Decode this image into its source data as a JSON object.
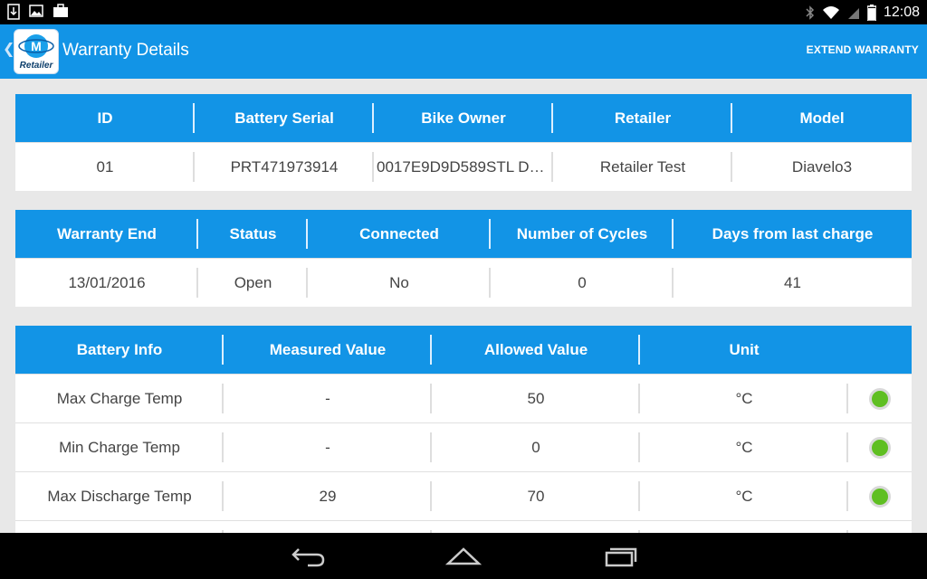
{
  "status_bar": {
    "time": "12:08",
    "left_icons": [
      "download-icon",
      "image-icon",
      "briefcase-icon"
    ],
    "right_icons": [
      "bluetooth-icon",
      "wifi-icon",
      "signal-icon",
      "battery-icon"
    ]
  },
  "action_bar": {
    "logo_text": "Retailer",
    "title": "Warranty Details",
    "action": "EXTEND WARRANTY"
  },
  "table1": {
    "headers": [
      "ID",
      "Battery Serial",
      "Bike Owner",
      "Retailer",
      "Model"
    ],
    "row": [
      "01",
      "PRT471973914",
      "0017E9D9D589STL D…",
      "Retailer Test",
      "Diavelo3"
    ]
  },
  "table2": {
    "headers": [
      "Warranty End",
      "Status",
      "Connected",
      "Number of Cycles",
      "Days from last charge"
    ],
    "row": [
      "13/01/2016",
      "Open",
      "No",
      "0",
      "41"
    ]
  },
  "table3": {
    "headers": [
      "Battery Info",
      "Measured Value",
      "Allowed Value",
      "Unit"
    ],
    "rows": [
      {
        "label": "Max Charge Temp",
        "measured": "-",
        "allowed": "50",
        "unit": "°C",
        "status_color": "#5fbf22"
      },
      {
        "label": "Min Charge Temp",
        "measured": "-",
        "allowed": "0",
        "unit": "°C",
        "status_color": "#5fbf22"
      },
      {
        "label": "Max Discharge Temp",
        "measured": "29",
        "allowed": "70",
        "unit": "°C",
        "status_color": "#5fbf22"
      }
    ]
  },
  "nav_bar": {
    "buttons": [
      "back-icon",
      "home-icon",
      "recents-icon"
    ]
  },
  "colors": {
    "accent": "#1294e6",
    "status_ok": "#5fbf22"
  }
}
